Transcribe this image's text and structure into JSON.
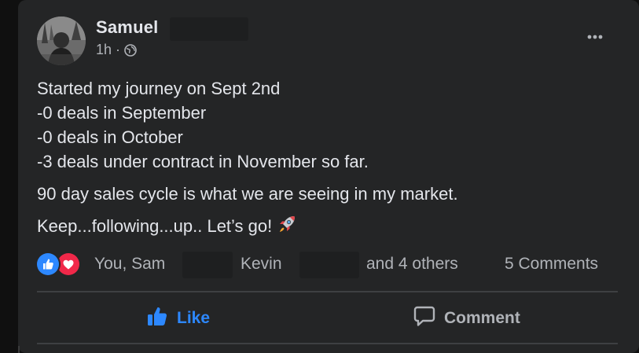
{
  "post": {
    "author": "Samuel",
    "time": "1h",
    "separator": "·",
    "audience_icon": "public-globe-icon",
    "body": {
      "line1": "Started my journey on Sept 2nd",
      "line2": "-0 deals in September",
      "line3": "-0 deals in October",
      "line4": "-3 deals under contract in November so far.",
      "para2": "90 day sales cycle is what we are seeing in my market.",
      "para3": "Keep...following...up.. Let’s go!"
    },
    "emoji": "rocket-emoji"
  },
  "reactions": {
    "icons": [
      "like-reaction-icon",
      "love-reaction-icon"
    ],
    "name1": "You, Sam",
    "name2": "Kevin",
    "others": "and 4 others",
    "comments": "5 Comments"
  },
  "actions": {
    "like_label": "Like",
    "comment_label": "Comment"
  },
  "colors": {
    "background": "#242526",
    "text": "#e4e6eb",
    "secondary": "#b0b3b8",
    "accent": "#2d88ff",
    "love": "#f02849"
  }
}
